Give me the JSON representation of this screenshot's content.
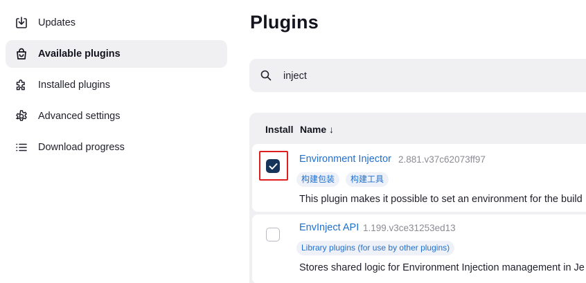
{
  "sidebar": {
    "items": [
      {
        "label": "Updates",
        "icon": "download-icon",
        "active": false
      },
      {
        "label": "Available plugins",
        "icon": "shopping-bag-icon",
        "active": true
      },
      {
        "label": "Installed plugins",
        "icon": "puzzle-icon",
        "active": false
      },
      {
        "label": "Advanced settings",
        "icon": "gear-icon",
        "active": false
      },
      {
        "label": "Download progress",
        "icon": "list-icon",
        "active": false
      }
    ]
  },
  "main": {
    "title": "Plugins",
    "search": {
      "value": "inject"
    },
    "table": {
      "columns": [
        "Install",
        "Name ↓"
      ],
      "rows": [
        {
          "checked": true,
          "name": "Environment Injector",
          "version": "2.881.v37c62073ff97",
          "tags": [
            "构建包装",
            "构建工具"
          ],
          "description": "This plugin makes it possible to set an environment for the build"
        },
        {
          "checked": false,
          "name": "EnvInject API",
          "version": "1.199.v3ce31253ed13",
          "tags": [
            "Library plugins (for use by other plugins)"
          ],
          "description": "Stores shared logic for Environment Injection management in Je"
        }
      ]
    }
  },
  "colors": {
    "accent_link": "#1f6fce",
    "checkbox_checked": "#17345a",
    "highlight_border": "#e01e1e",
    "panel_bg": "#f0f0f3"
  }
}
